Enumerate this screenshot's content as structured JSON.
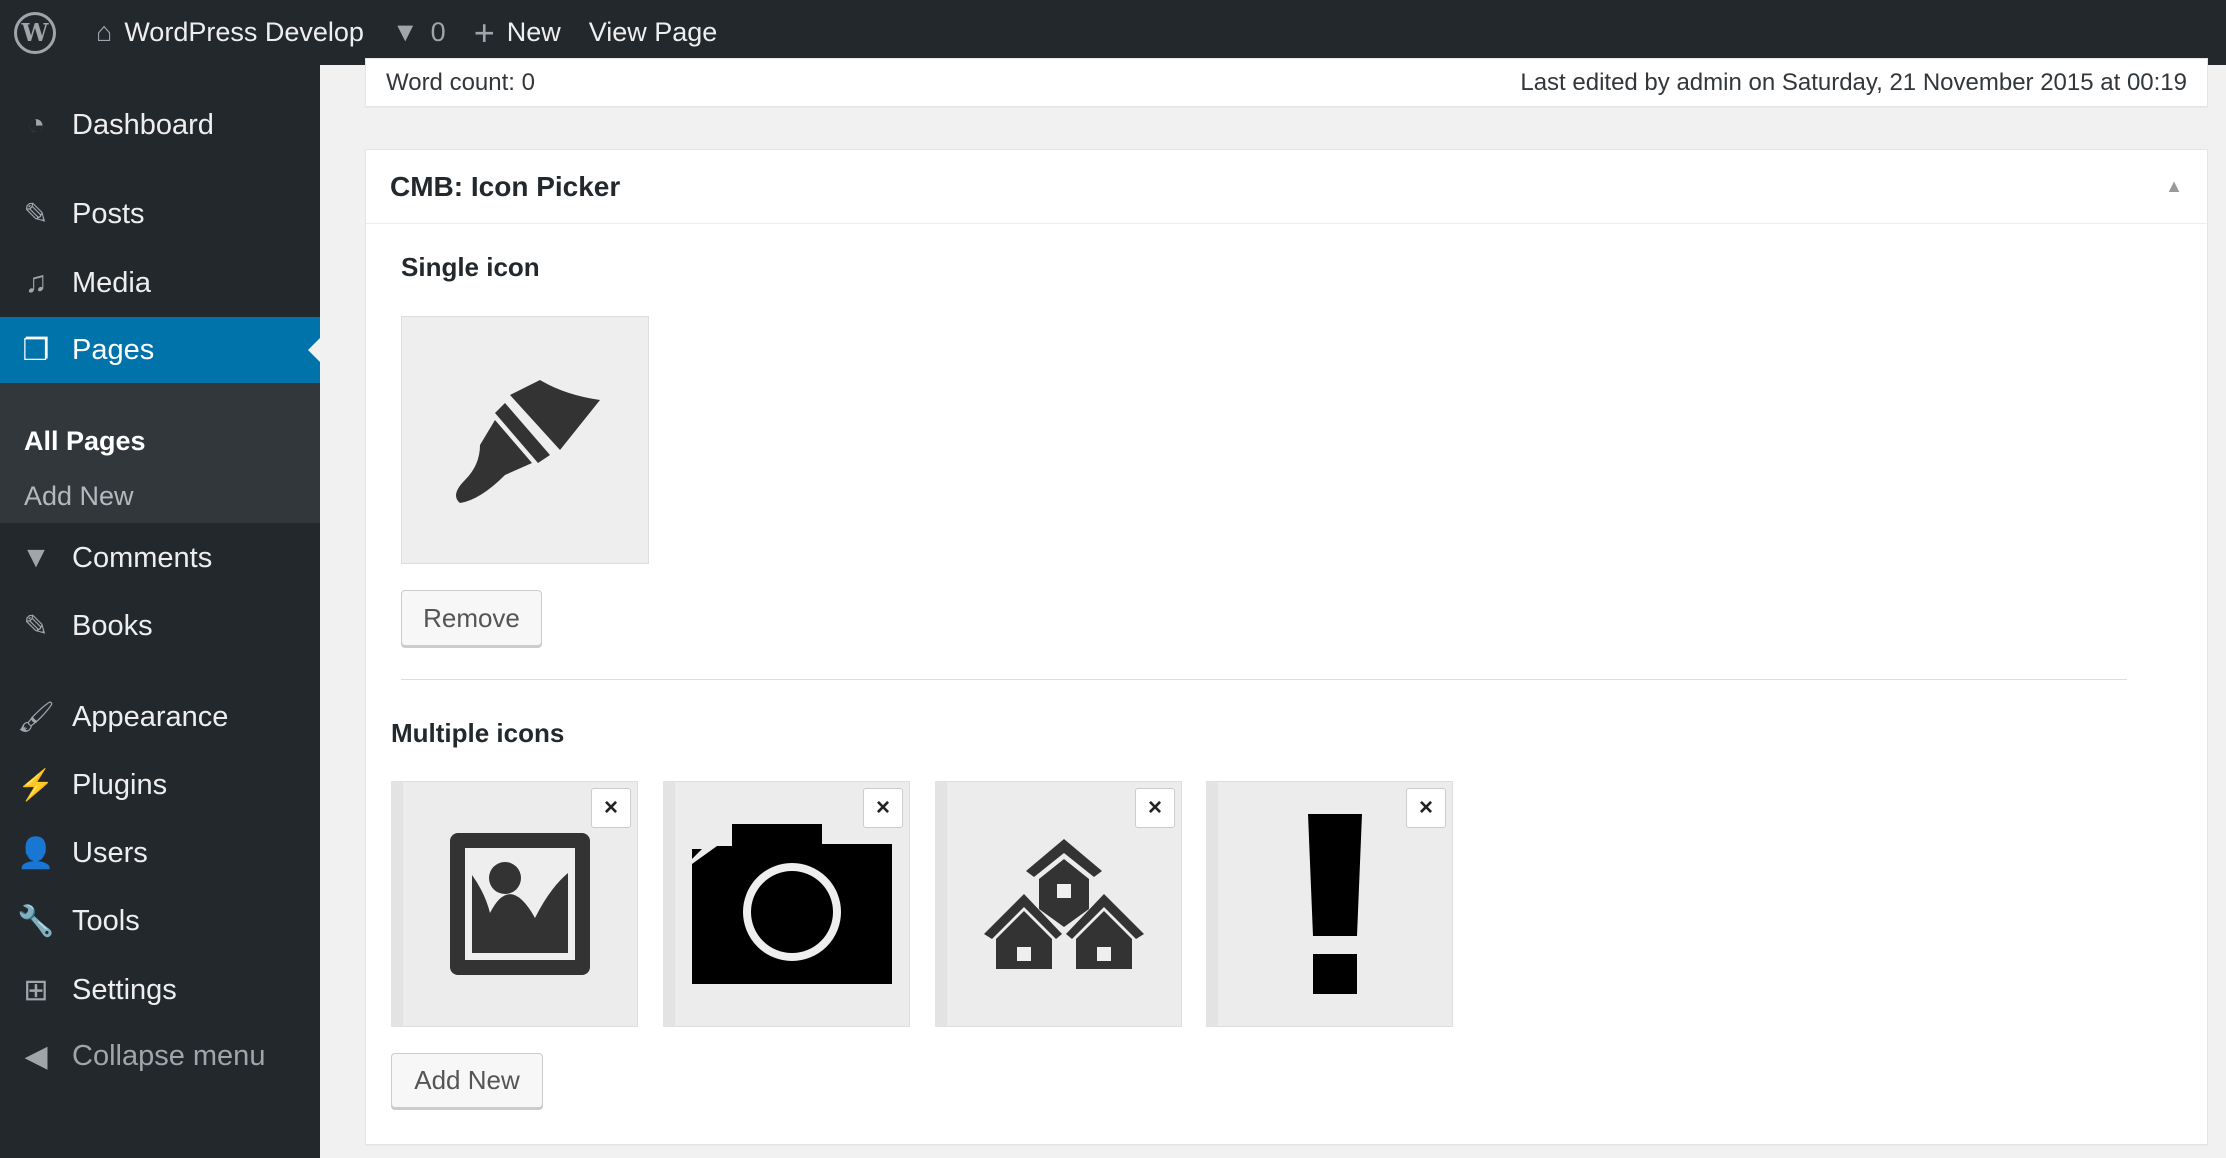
{
  "topbar": {
    "site": "WordPress Develop",
    "comments": "0",
    "new": "New",
    "view": "View Page"
  },
  "sidebar": {
    "items": [
      "Dashboard",
      "Posts",
      "Media",
      "Pages",
      "Comments",
      "Books",
      "Appearance",
      "Plugins",
      "Users",
      "Tools",
      "Settings",
      "Collapse menu"
    ],
    "sub": [
      "All Pages",
      "Add New"
    ]
  },
  "status": {
    "word_count": "Word count: 0",
    "last_edited": "Last edited by admin on Saturday, 21 November 2015 at 00:19"
  },
  "metabox": {
    "title": "CMB: Icon Picker",
    "single_label": "Single icon",
    "remove": "Remove",
    "multiple_label": "Multiple icons",
    "add_new": "Add New",
    "remove_x": "×",
    "icons": [
      "format-image-icon",
      "camera-icon",
      "groups-icon",
      "warning-icon"
    ]
  }
}
